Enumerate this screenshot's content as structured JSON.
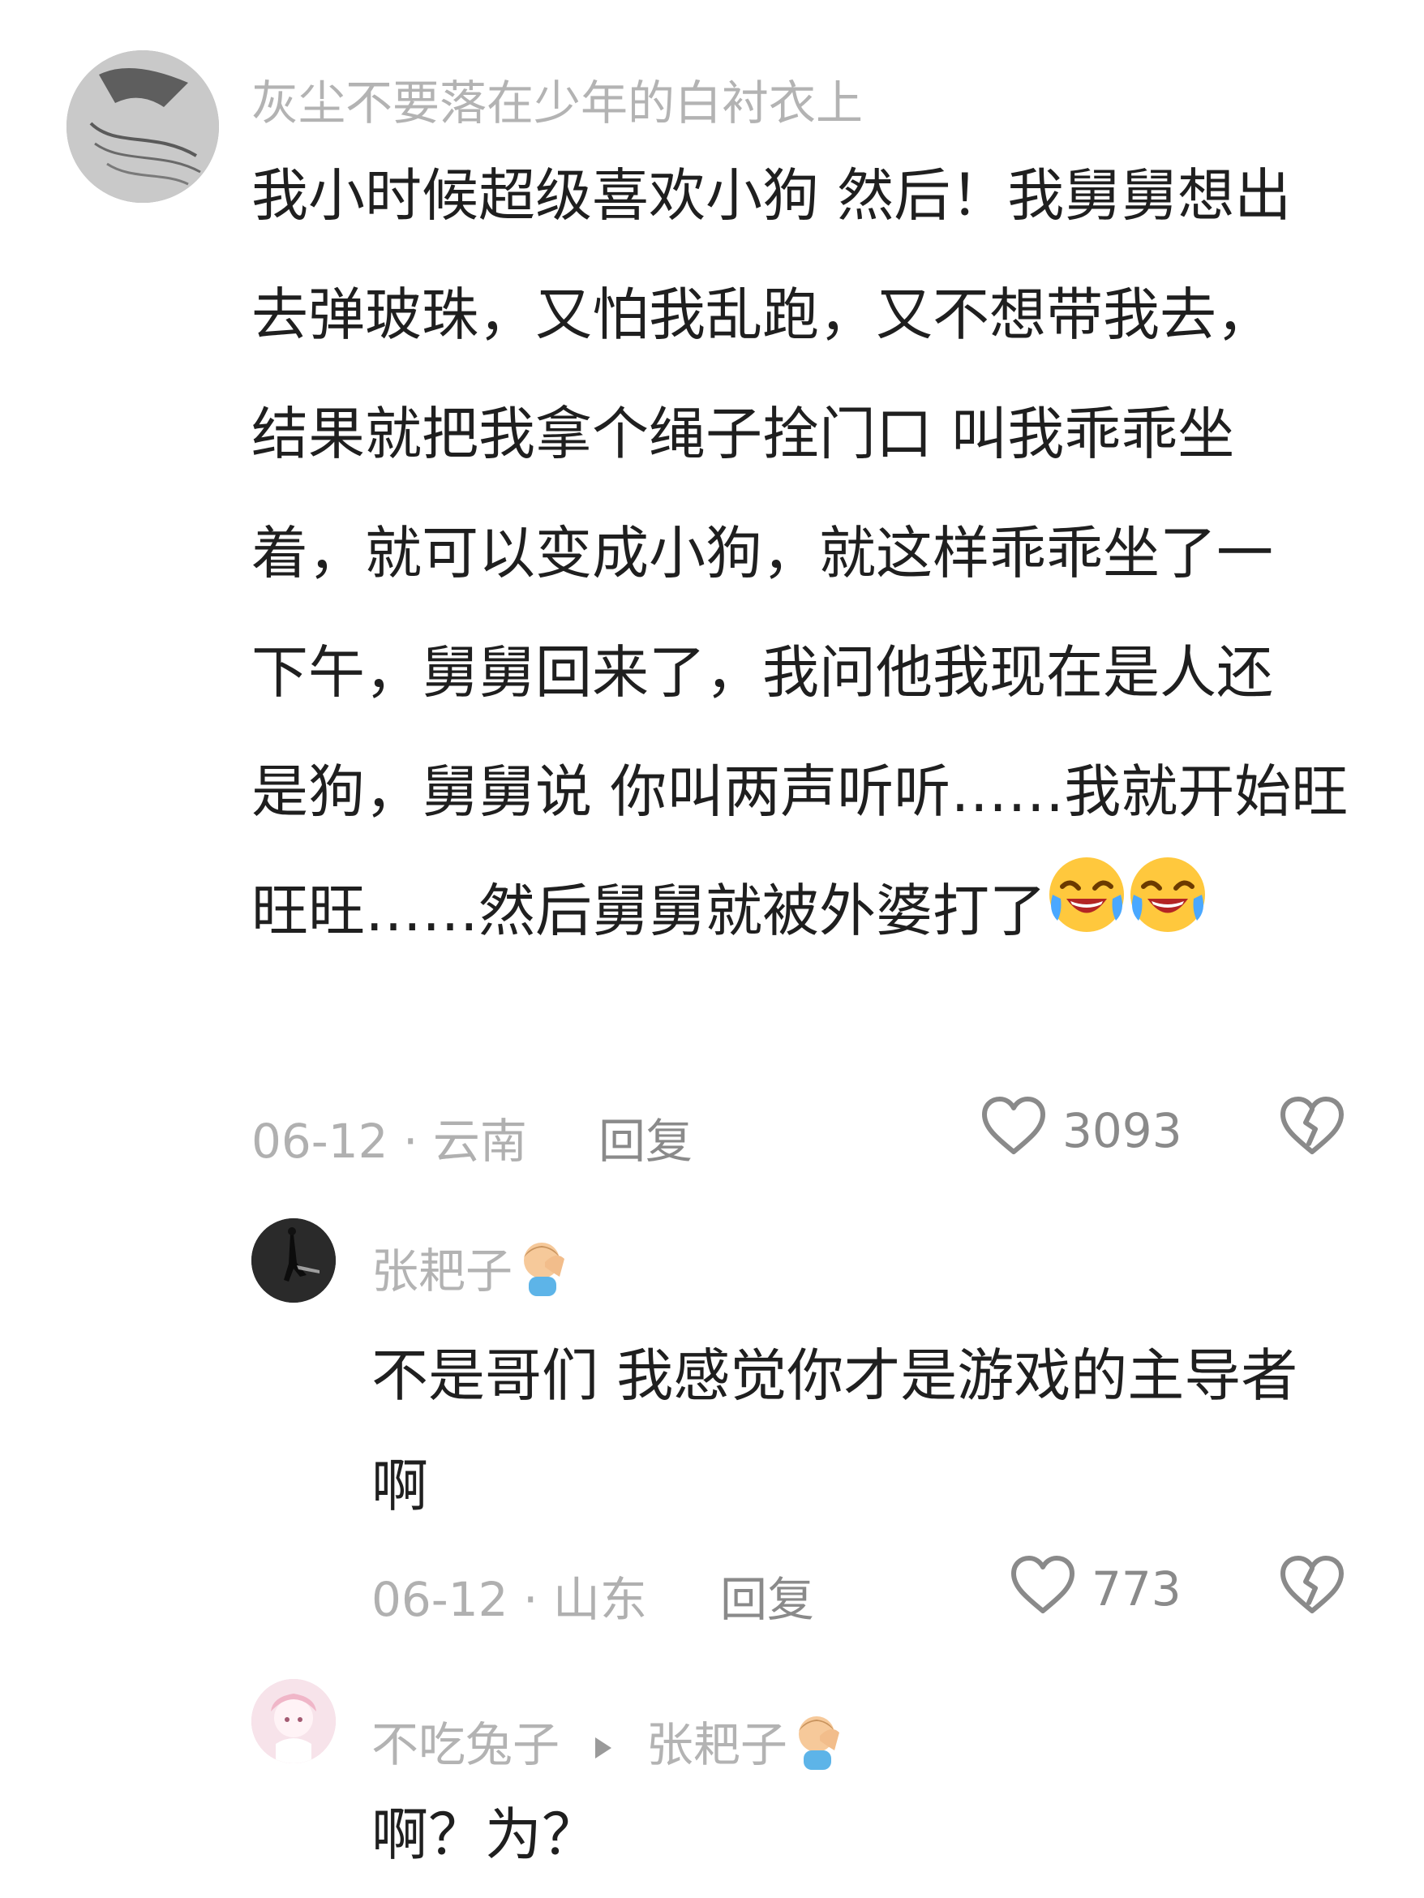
{
  "comment": {
    "username": "灰尘不要落在少年的白衬衣上",
    "lines": [
      "我小时候超级喜欢小狗  然后！我舅舅想出",
      "去弹玻珠，又怕我乱跑，又不想带我去，",
      "结果就把我拿个绳子拴门口  叫我乖乖坐",
      "着，就可以变成小狗，就这样乖乖坐了一",
      "下午，舅舅回来了，我问他我现在是人还",
      "是狗，舅舅说 你叫两声听听……我就开始旺",
      "旺旺……然后舅舅就被外婆打了"
    ],
    "emoji": [
      "laughing-crying-emoji",
      "laughing-crying-emoji"
    ],
    "meta": "06-12 · 云南",
    "reply_label": "回复",
    "likes": "3093",
    "icons": {
      "like": "heart-outline-icon",
      "dislike": "broken-heart-icon"
    }
  },
  "reply1": {
    "username": "张耙子",
    "user_emoji": "facepalm-emoji",
    "lines": [
      "不是哥们  我感觉你才是游戏的主导者",
      "啊"
    ],
    "meta": "06-12 · 山东",
    "reply_label": "回复",
    "likes": "773"
  },
  "reply2": {
    "username": "不吃兔子",
    "reply_to": "张耙子",
    "user_emoji": "facepalm-emoji",
    "text": "啊？为？"
  },
  "colors": {
    "text": "#1f1f1f",
    "username": "#b3b3b3",
    "meta": "#b0b0b0",
    "icon": "#8a8a8a",
    "emoji_yellow": "#ffc83d"
  }
}
